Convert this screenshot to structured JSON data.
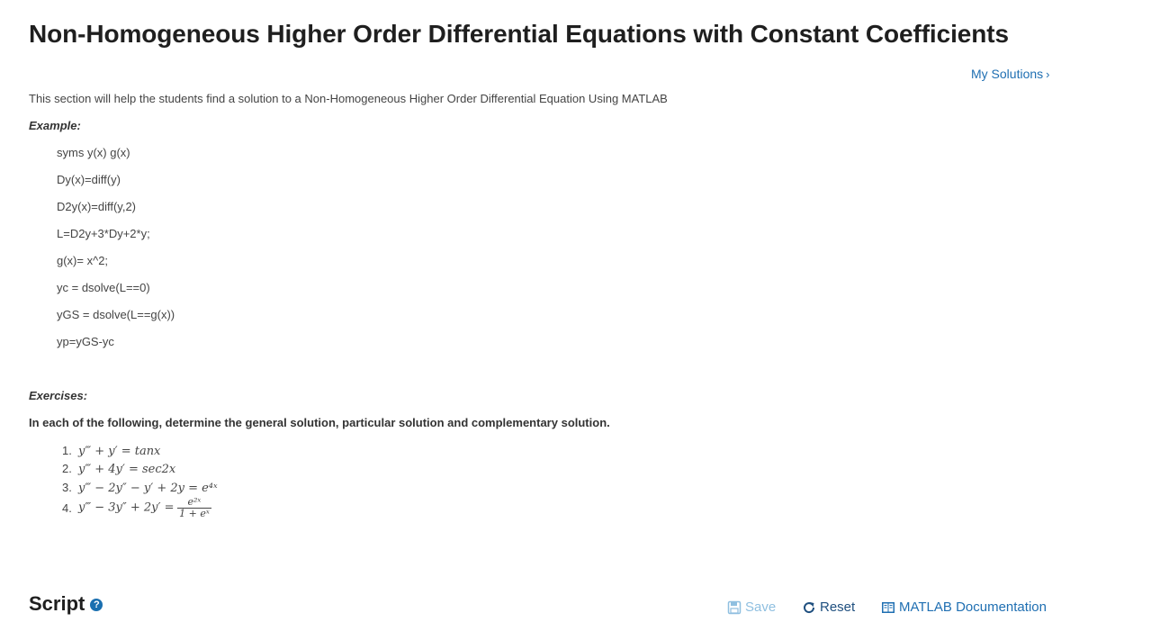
{
  "page_title": "Non-Homogeneous Higher Order Differential Equations with Constant Coefficients",
  "my_solutions_link": "My Solutions",
  "intro": "This section will help the students find a solution to a Non-Homogeneous Higher Order Differential Equation Using MATLAB",
  "example_label": "Example:",
  "code_lines": [
    "syms y(x) g(x)",
    "Dy(x)=diff(y)",
    "D2y(x)=diff(y,2)",
    "L=D2y+3*Dy+2*y;",
    "g(x)= x^2;",
    "yc = dsolve(L==0)",
    "yGS = dsolve(L==g(x))",
    "yp=yGS-yc"
  ],
  "exercises_label": "Exercises:",
  "instruction": "In each of the following, determine the general solution, particular solution and complementary solution.",
  "exercises": [
    {
      "num": "1.",
      "math": "y‴ + y′ = tanx"
    },
    {
      "num": "2.",
      "math": "y‴ + 4y′ = sec2x"
    },
    {
      "num": "3.",
      "math": "y‴ − 2y″ − y′ + 2y = e⁴ˣ"
    },
    {
      "num": "4.",
      "math": "y‴ − 3y″ + 2y′ =",
      "frac_num": "e²ˣ",
      "frac_den": "1 + eˣ"
    }
  ],
  "script_section": {
    "title": "Script",
    "help_icon": "question-icon"
  },
  "toolbar": {
    "save_label": "Save",
    "reset_label": "Reset",
    "doc_label": "MATLAB Documentation"
  },
  "colors": {
    "link": "#1f6fb2",
    "save_disabled": "#8fbfe0",
    "title": "#1f1f1f"
  }
}
